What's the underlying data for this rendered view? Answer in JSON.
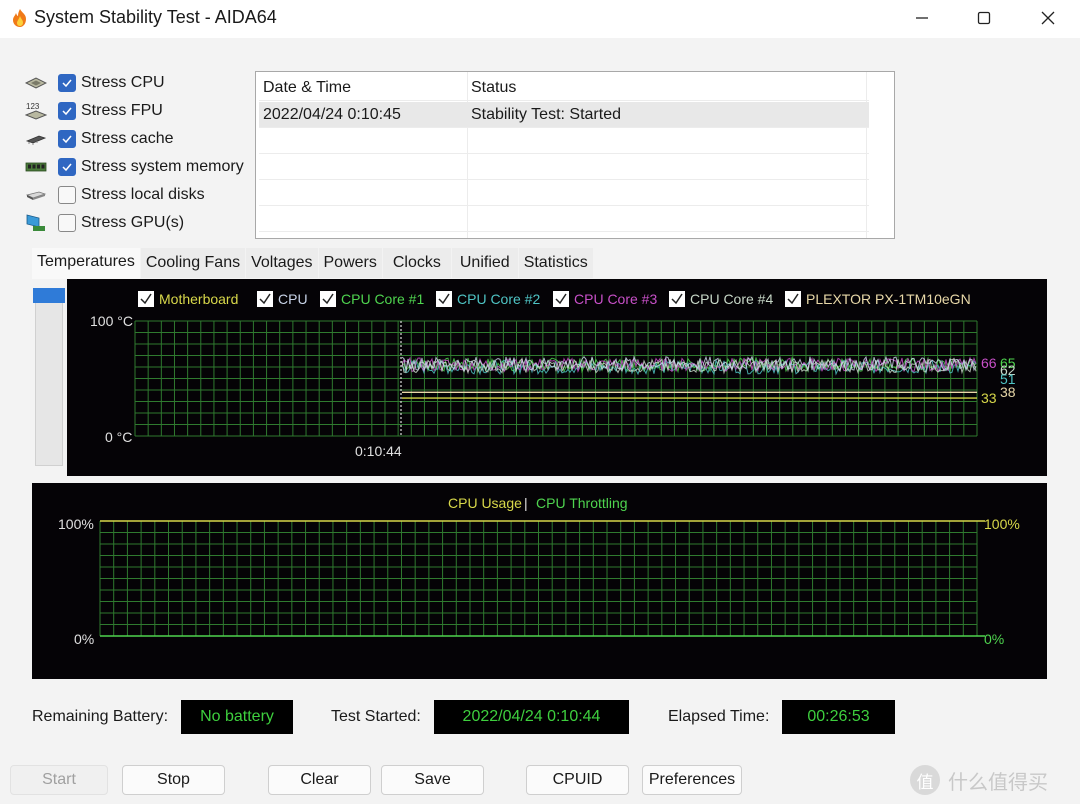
{
  "window": {
    "title": "System Stability Test - AIDA64",
    "icon": "flame-icon",
    "controls": [
      "minimize",
      "maximize",
      "close"
    ]
  },
  "stress_options": [
    {
      "label": "Stress CPU",
      "checked": true,
      "icon": "cpu-chip-icon"
    },
    {
      "label": "Stress FPU",
      "checked": true,
      "icon": "fpu-123-icon"
    },
    {
      "label": "Stress cache",
      "checked": true,
      "icon": "cache-chip-icon"
    },
    {
      "label": "Stress system memory",
      "checked": true,
      "icon": "memory-module-icon"
    },
    {
      "label": "Stress local disks",
      "checked": false,
      "icon": "disk-drive-icon"
    },
    {
      "label": "Stress GPU(s)",
      "checked": false,
      "icon": "gpu-card-icon"
    }
  ],
  "log": {
    "columns": [
      "Date & Time",
      "Status"
    ],
    "rows": [
      {
        "datetime": "2022/04/24 0:10:45",
        "status": "Stability Test: Started"
      }
    ]
  },
  "tabs": [
    {
      "label": "Temperatures",
      "active": true
    },
    {
      "label": "Cooling Fans",
      "active": false
    },
    {
      "label": "Voltages",
      "active": false
    },
    {
      "label": "Powers",
      "active": false
    },
    {
      "label": "Clocks",
      "active": false
    },
    {
      "label": "Unified",
      "active": false
    },
    {
      "label": "Statistics",
      "active": false
    }
  ],
  "temperature_graph": {
    "y_max_label": "100 °C",
    "y_min_label": "0 °C",
    "start_time_label": "0:10:44",
    "legend": [
      {
        "label": "Motherboard",
        "checked": true,
        "color": "#d8d84a"
      },
      {
        "label": "CPU",
        "checked": true,
        "color": "#c9d4e8"
      },
      {
        "label": "CPU Core #1",
        "checked": true,
        "color": "#4fd44f"
      },
      {
        "label": "CPU Core #2",
        "checked": true,
        "color": "#4fc4c4"
      },
      {
        "label": "CPU Core #3",
        "checked": true,
        "color": "#c850c8"
      },
      {
        "label": "CPU Core #4",
        "checked": true,
        "color": "#c8d8c8"
      },
      {
        "label": "PLEXTOR PX-1TM10eGN",
        "checked": true,
        "color": "#e8d8a8"
      }
    ],
    "current_values": [
      {
        "series": "CPU Core #3",
        "value": "66",
        "color": "#c850c8"
      },
      {
        "series": "CPU Core #1",
        "value": "65",
        "color": "#4fd44f"
      },
      {
        "series": "CPU Core #4",
        "value": "62",
        "color": "#c8d8c8"
      },
      {
        "series": "CPU Core #2",
        "value": "51",
        "color": "#4fc4c4"
      },
      {
        "series": "PLEXTOR PX-1TM10eGN",
        "value": "38",
        "color": "#e8d8a8"
      },
      {
        "series": "Motherboard",
        "value": "33",
        "color": "#d8d84a"
      }
    ]
  },
  "usage_graph": {
    "legend_usage": "CPU Usage",
    "legend_separator": "|",
    "legend_throttling": "CPU Throttling",
    "left_max_label": "100%",
    "left_min_label": "0%",
    "right_max_label": "100%",
    "right_min_label": "0%",
    "usage_color": "#d8d84a",
    "throttling_color": "#4fd44f",
    "cpu_usage_percent": 100,
    "cpu_throttling_percent": 0
  },
  "status": {
    "battery_label": "Remaining Battery:",
    "battery_value": "No battery",
    "test_started_label": "Test Started:",
    "test_started_value": "2022/04/24 0:10:44",
    "elapsed_label": "Elapsed Time:",
    "elapsed_value": "00:26:53"
  },
  "buttons": {
    "start": "Start",
    "stop": "Stop",
    "clear": "Clear",
    "save": "Save",
    "cpuid": "CPUID",
    "preferences": "Preferences"
  },
  "watermark": {
    "badge": "值",
    "text": "什么值得买"
  }
}
